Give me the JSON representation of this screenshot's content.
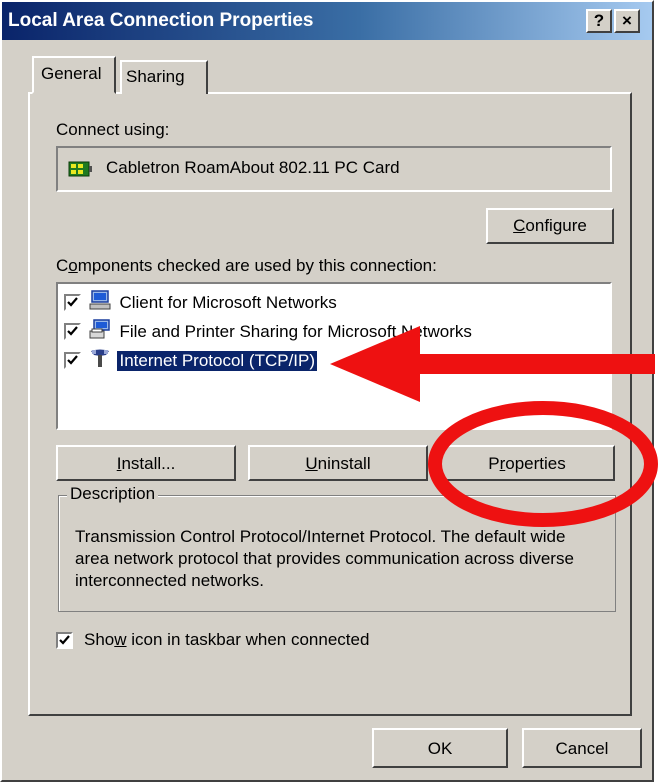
{
  "window": {
    "title": "Local Area Connection Properties",
    "help_label": "?",
    "close_label": "×"
  },
  "tabs": [
    {
      "label": "General",
      "active": true
    },
    {
      "label": "Sharing",
      "active": false
    }
  ],
  "connect_using": {
    "label": "Connect using:",
    "adapter": "Cabletron RoamAbout 802.11 PC Card",
    "configure_button": {
      "accel": "C",
      "rest": "onfigure"
    }
  },
  "components": {
    "label_accel": "o",
    "label_pre": "C",
    "label_post": "mponents checked are used by this connection:",
    "items": [
      {
        "label": "Client for Microsoft Networks",
        "checked": true,
        "icon": "network-client-icon",
        "selected": false
      },
      {
        "label": "File and Printer Sharing for Microsoft Networks",
        "checked": true,
        "icon": "file-printer-sharing-icon",
        "selected": false
      },
      {
        "label": "Internet Protocol (TCP/IP)",
        "checked": true,
        "icon": "protocol-icon",
        "selected": true
      }
    ]
  },
  "buttons": {
    "install": {
      "accel": "I",
      "rest": "nstall..."
    },
    "uninstall": {
      "accel": "U",
      "rest": "ninstall"
    },
    "properties": {
      "pre": "P",
      "accel": "r",
      "rest": "operties"
    }
  },
  "description": {
    "title": "Description",
    "text": "Transmission Control Protocol/Internet Protocol. The default wide area network protocol that provides communication across diverse interconnected networks."
  },
  "show_icon": {
    "checked": true,
    "pre": "Sho",
    "accel": "w",
    "post": " icon in taskbar when connected"
  },
  "footer": {
    "ok_label": "OK",
    "cancel_label": "Cancel"
  },
  "annotation": {
    "arrow_color": "#ee1111",
    "circle_color": "#ee1111"
  }
}
